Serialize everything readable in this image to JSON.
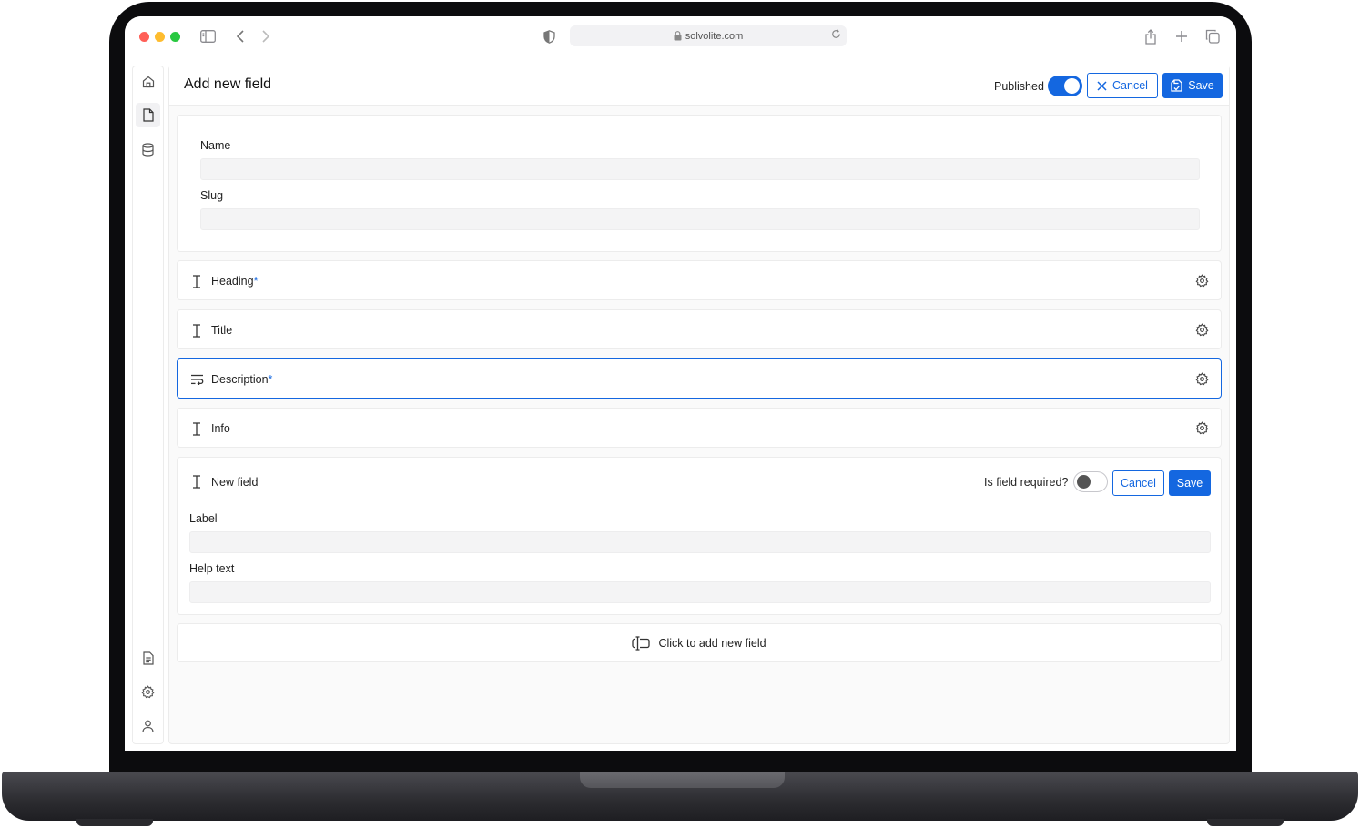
{
  "browser": {
    "url": "solvolite.com",
    "colors": {
      "close": "#ff5f57",
      "minimize": "#febc2e",
      "zoom": "#28c840"
    }
  },
  "header": {
    "title": "Add new field",
    "published_label": "Published",
    "published": true,
    "cancel_label": "Cancel",
    "save_label": "Save"
  },
  "form": {
    "name_label": "Name",
    "name_value": "",
    "slug_label": "Slug",
    "slug_value": ""
  },
  "fields": [
    {
      "label": "Heading",
      "required_mark": "*",
      "icon": "text-cursor-icon"
    },
    {
      "label": "Title",
      "required_mark": "",
      "icon": "text-cursor-icon"
    },
    {
      "label": "Description",
      "required_mark": "*",
      "icon": "text-wrap-icon"
    },
    {
      "label": "Info",
      "required_mark": "",
      "icon": "text-cursor-icon"
    }
  ],
  "new_field": {
    "title": "New field",
    "required_label": "Is field required?",
    "required": false,
    "cancel_label": "Cancel",
    "save_label": "Save",
    "label_label": "Label",
    "label_value": "",
    "help_label": "Help text",
    "help_value": ""
  },
  "add_field": {
    "label": "Click to add new field"
  },
  "theme": {
    "accent": "#1467e0"
  }
}
